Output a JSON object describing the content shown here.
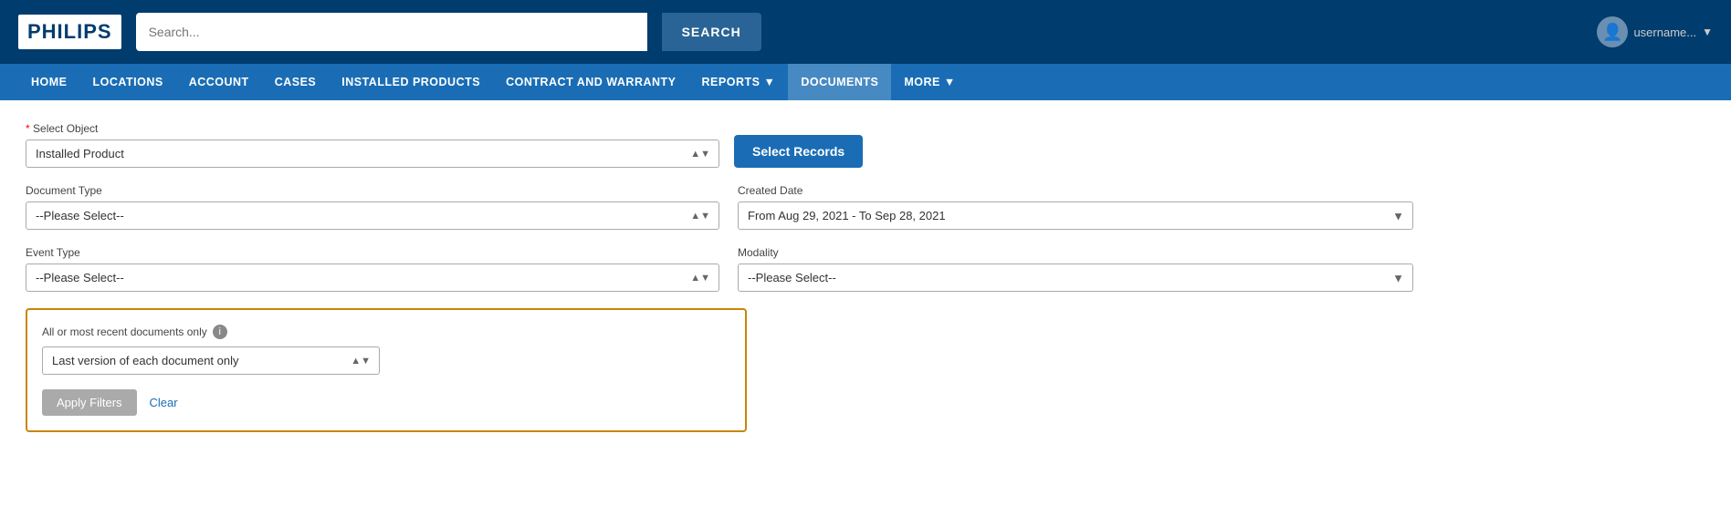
{
  "header": {
    "logo": "PHILIPS",
    "search_placeholder": "Search...",
    "search_button": "SEARCH",
    "user_name": "username..."
  },
  "nav": {
    "items": [
      {
        "label": "HOME",
        "has_dropdown": false
      },
      {
        "label": "LOCATIONS",
        "has_dropdown": false
      },
      {
        "label": "ACCOUNT",
        "has_dropdown": false
      },
      {
        "label": "CASES",
        "has_dropdown": false
      },
      {
        "label": "INSTALLED PRODUCTS",
        "has_dropdown": false
      },
      {
        "label": "CONTRACT AND WARRANTY",
        "has_dropdown": false
      },
      {
        "label": "REPORTS",
        "has_dropdown": true
      },
      {
        "label": "DOCUMENTS",
        "has_dropdown": false,
        "active": true
      },
      {
        "label": "MORE",
        "has_dropdown": true
      }
    ]
  },
  "form": {
    "select_object_label": "Select Object",
    "select_object_value": "Installed Product",
    "select_records_btn": "Select Records",
    "document_type_label": "Document Type",
    "document_type_placeholder": "--Please Select--",
    "event_type_label": "Event Type",
    "event_type_placeholder": "--Please Select--",
    "created_date_label": "Created Date",
    "created_date_value": "From Aug 29, 2021 - To Sep 28, 2021",
    "modality_label": "Modality",
    "modality_placeholder": "--Please Select--",
    "filter_box_label": "All or most recent documents only",
    "version_label": "Last version of each document only",
    "apply_btn": "Apply Filters",
    "clear_link": "Clear"
  }
}
